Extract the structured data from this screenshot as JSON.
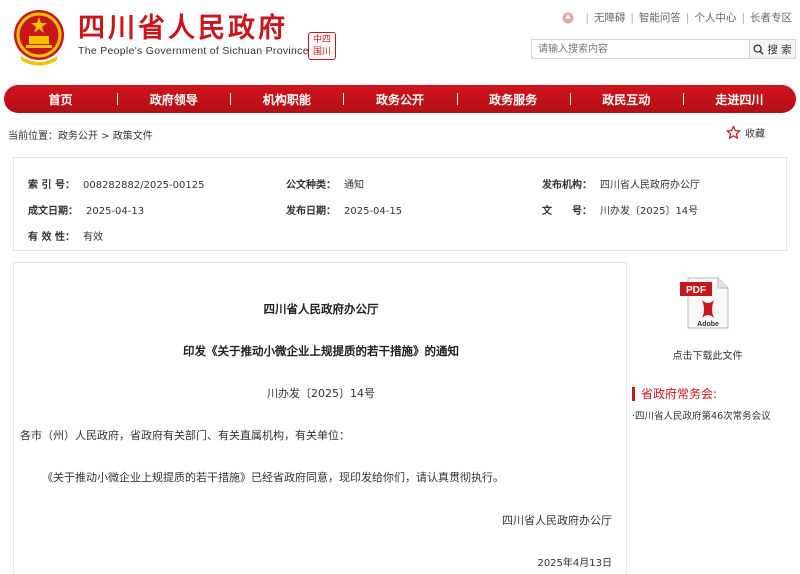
{
  "header": {
    "title": "四川省人民政府",
    "subtitle": "The People's Government of Sichuan Province",
    "seal_text": "中国四川",
    "top_links": [
      "无障碍",
      "智能问答",
      "个人中心",
      "长者专区"
    ],
    "search_placeholder": "请输入搜索内容",
    "search_button": "搜 索"
  },
  "nav": {
    "items": [
      "首页",
      "政府领导",
      "机构职能",
      "政务公开",
      "政务服务",
      "政民互动",
      "走进四川"
    ]
  },
  "breadcrumb": {
    "prefix": "当前位置：",
    "items": [
      "政务公开",
      "政策文件"
    ],
    "separator": " > "
  },
  "favorite": {
    "label": "收藏"
  },
  "meta": {
    "index_label": "索 引 号：",
    "index_value": "008282882/2025-00125",
    "type_label": "公文种类：",
    "type_value": "通知",
    "issuer_label": "发布机构：",
    "issuer_value": "四川省人民政府办公厅",
    "created_label": "成文日期：",
    "created_value": "2025-04-13",
    "published_label": "发布日期：",
    "published_value": "2025-04-15",
    "docnum_label": "文　　号：",
    "docnum_value": "川办发〔2025〕14号",
    "validity_label": "有 效 性：",
    "validity_value": "有效"
  },
  "document": {
    "issuer": "四川省人民政府办公厅",
    "title": "印发《关于推动小微企业上规提质的若干措施》的通知",
    "number": "川办发〔2025〕14号",
    "recipients": "各市（州）人民政府，省政府有关部门、有关直属机构，有关单位：",
    "body": "《关于推动小微企业上规提质的若干措施》已经省政府同意，现印发给你们，请认真贯彻执行。",
    "signature": "四川省人民政府办公厅",
    "date": "2025年4月13日"
  },
  "sidebar": {
    "pdf_label": "PDF",
    "pdf_brand": "Adobe",
    "download_label": "点击下载此文件",
    "related_title": "省政府常务会:",
    "related_item": "·四川省人民政府第46次常务会议"
  },
  "colors": {
    "brand_red": "#c8161d",
    "nav_red": "#d1141b"
  }
}
